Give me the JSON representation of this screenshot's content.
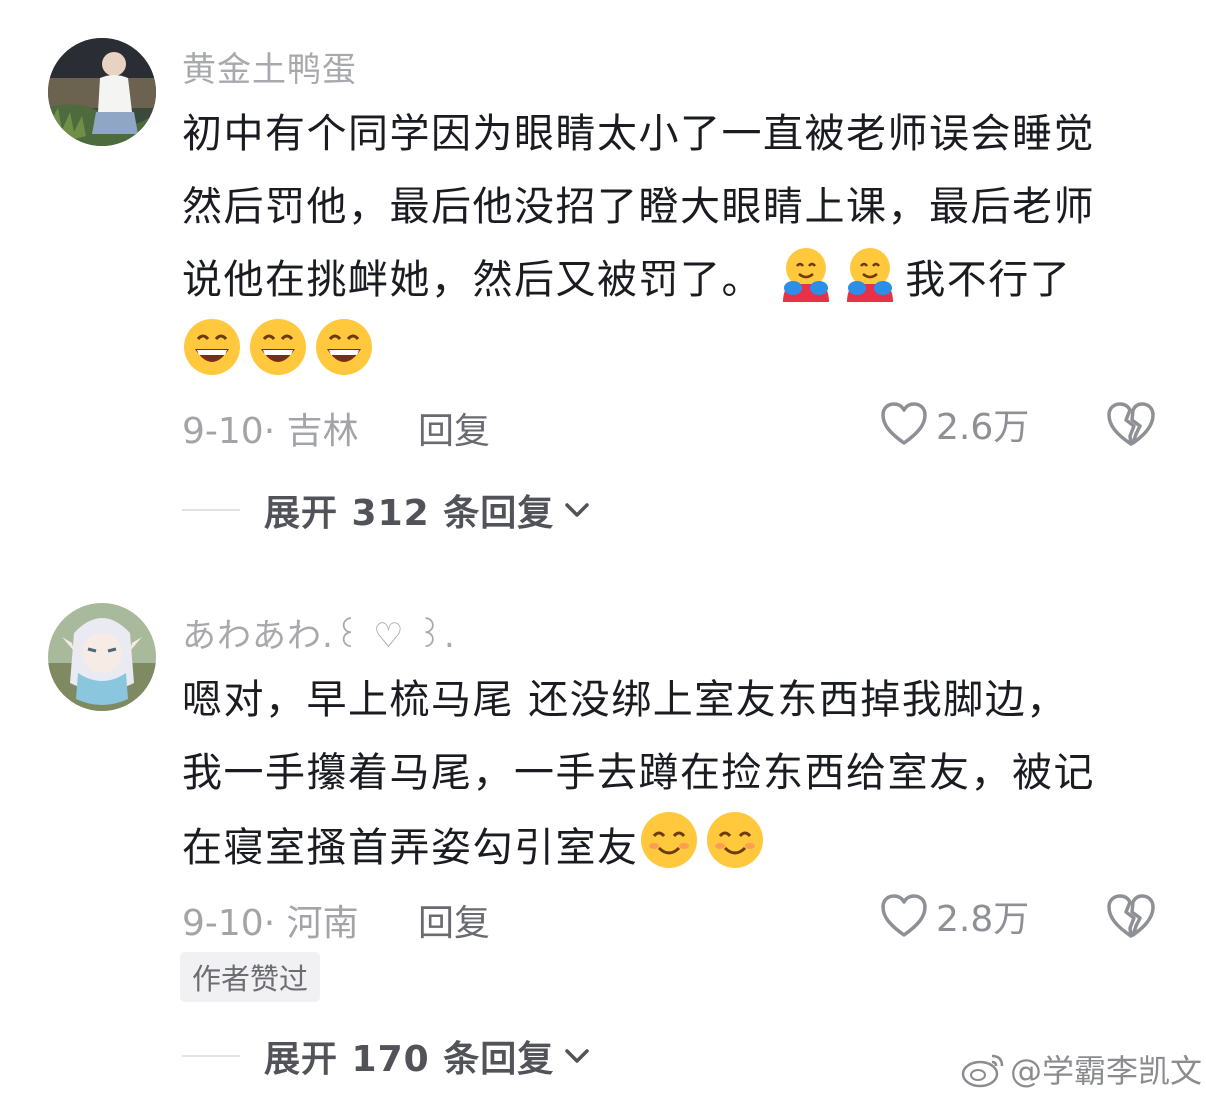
{
  "comments": [
    {
      "username": "黄金土鸭蛋",
      "lines": [
        "初中有个同学因为眼睛太小了一直被老师误会睡觉",
        "然后罚他，最后他没招了瞪大眼睛上课，最后老师",
        "说他在挑衅她，然后又被罚了。",
        "我不行了"
      ],
      "date": "9-10",
      "location": "吉林",
      "reply_label": "回复",
      "like_count": "2.6万",
      "expand_label": "展开 312 条回复",
      "line3_emoji": "hugging-face-emoji",
      "line4_emoji": "grinning-face-emoji"
    },
    {
      "username": "あわあわ.꒰ ♡ ꒱.",
      "lines": [
        "嗯对，早上梳马尾 还没绑上室友东西掉我脚边，",
        "我一手攥着马尾，一手去蹲在捡东西给室友，被记",
        "在寝室搔首弄姿勾引室友"
      ],
      "date": "9-10",
      "location": "河南",
      "reply_label": "回复",
      "like_count": "2.8万",
      "badge": "作者赞过",
      "expand_label": "展开 170 条回复",
      "line3_emoji": "smiling-face-emoji"
    }
  ],
  "watermark": "@学霸李凯文",
  "colors": {
    "username": "#a8a9ad",
    "body_text": "#1b1c22",
    "meta": "#a3a4a8",
    "emoji_yellow": "#ffc83d"
  }
}
